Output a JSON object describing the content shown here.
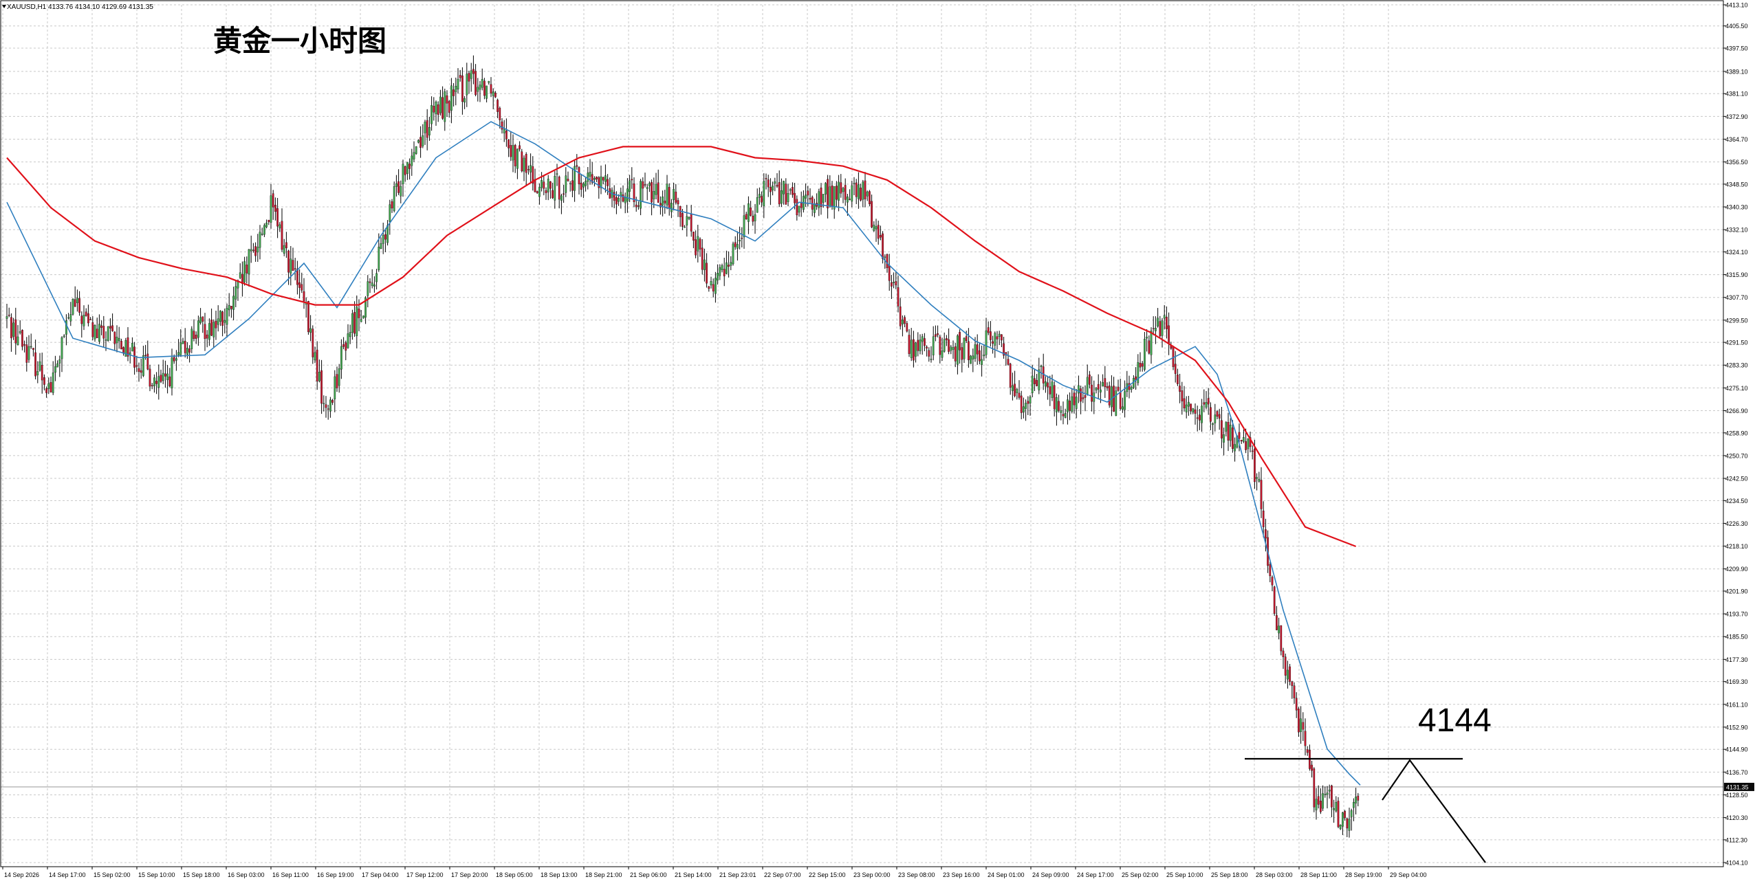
{
  "symbol_header": "XAUUSD,H1  4133.76 4134.10 4129.69 4131.35",
  "chart_title": "黄金一小时图",
  "annotation_level_text": "4144",
  "current_price_label": "4131.35",
  "colors": {
    "background": "#ffffff",
    "grid": "#c8c8c8",
    "bull_candle": "#3fa34d",
    "bear_candle": "#c0162c",
    "wick": "#000000",
    "ma_fast": "#2f7fbf",
    "ma_slow": "#e0111a",
    "annotation": "#000000",
    "price_tag_bg": "#0a0a0a",
    "price_tag_text": "#ffffff"
  },
  "chart_data": {
    "type": "candlestick",
    "symbol": "XAUUSD",
    "timeframe": "H1",
    "ylim": [
      4104.1,
      4413.1
    ],
    "y_ticks": [
      "4413.10",
      "4405.50",
      "4397.50",
      "4389.10",
      "4381.10",
      "4372.90",
      "4364.70",
      "4356.50",
      "4348.50",
      "4340.30",
      "4332.10",
      "4324.10",
      "4315.90",
      "4307.70",
      "4299.50",
      "4291.50",
      "4283.30",
      "4275.10",
      "4266.90",
      "4258.90",
      "4250.70",
      "4242.50",
      "4234.50",
      "4226.30",
      "4218.10",
      "4209.90",
      "4201.90",
      "4193.70",
      "4185.50",
      "4177.30",
      "4169.30",
      "4161.10",
      "4152.90",
      "4144.90",
      "4136.70",
      "4128.50",
      "4120.30",
      "4112.30",
      "4104.10"
    ],
    "x_ticks": [
      "14 Sep 2026",
      "14 Sep 17:00",
      "15 Sep 02:00",
      "15 Sep 10:00",
      "15 Sep 18:00",
      "16 Sep 03:00",
      "16 Sep 11:00",
      "16 Sep 19:00",
      "17 Sep 04:00",
      "17 Sep 12:00",
      "17 Sep 20:00",
      "18 Sep 05:00",
      "18 Sep 13:00",
      "18 Sep 21:00",
      "21 Sep 06:00",
      "21 Sep 14:00",
      "21 Sep 23:01",
      "22 Sep 07:00",
      "22 Sep 15:00",
      "23 Sep 00:00",
      "23 Sep 08:00",
      "23 Sep 16:00",
      "24 Sep 01:00",
      "24 Sep 09:00",
      "24 Sep 17:00",
      "25 Sep 02:00",
      "25 Sep 10:00",
      "25 Sep 18:00",
      "28 Sep 03:00",
      "28 Sep 11:00",
      "28 Sep 19:00",
      "29 Sep 04:00"
    ],
    "close_path": [
      [
        0,
        4300
      ],
      [
        10,
        4288
      ],
      [
        20,
        4275
      ],
      [
        30,
        4305
      ],
      [
        40,
        4295
      ],
      [
        55,
        4290
      ],
      [
        70,
        4275
      ],
      [
        85,
        4295
      ],
      [
        100,
        4300
      ],
      [
        110,
        4320
      ],
      [
        120,
        4340
      ],
      [
        135,
        4305
      ],
      [
        145,
        4265
      ],
      [
        155,
        4295
      ],
      [
        165,
        4310
      ],
      [
        180,
        4355
      ],
      [
        195,
        4375
      ],
      [
        210,
        4385
      ],
      [
        220,
        4385
      ],
      [
        230,
        4360
      ],
      [
        245,
        4345
      ],
      [
        255,
        4350
      ],
      [
        265,
        4350
      ],
      [
        280,
        4345
      ],
      [
        300,
        4345
      ],
      [
        310,
        4335
      ],
      [
        320,
        4310
      ],
      [
        330,
        4325
      ],
      [
        345,
        4350
      ],
      [
        360,
        4340
      ],
      [
        375,
        4345
      ],
      [
        390,
        4345
      ],
      [
        400,
        4320
      ],
      [
        410,
        4290
      ],
      [
        425,
        4290
      ],
      [
        440,
        4288
      ],
      [
        450,
        4295
      ],
      [
        460,
        4270
      ],
      [
        470,
        4280
      ],
      [
        480,
        4265
      ],
      [
        490,
        4275
      ],
      [
        505,
        4270
      ],
      [
        515,
        4285
      ],
      [
        525,
        4300
      ],
      [
        535,
        4270
      ],
      [
        545,
        4265
      ],
      [
        555,
        4258
      ],
      [
        565,
        4255
      ],
      [
        570,
        4233
      ],
      [
        575,
        4200
      ],
      [
        580,
        4175
      ],
      [
        585,
        4160
      ],
      [
        590,
        4150
      ],
      [
        595,
        4122
      ],
      [
        600,
        4130
      ],
      [
        605,
        4120
      ],
      [
        610,
        4118
      ],
      [
        615,
        4131
      ]
    ],
    "series": [
      {
        "name": "MA fast",
        "values": [
          [
            0,
            4342
          ],
          [
            30,
            4293
          ],
          [
            60,
            4286
          ],
          [
            90,
            4287
          ],
          [
            110,
            4300
          ],
          [
            135,
            4320
          ],
          [
            150,
            4304
          ],
          [
            170,
            4330
          ],
          [
            195,
            4358
          ],
          [
            220,
            4371
          ],
          [
            240,
            4363
          ],
          [
            255,
            4355
          ],
          [
            275,
            4345
          ],
          [
            290,
            4342
          ],
          [
            320,
            4336
          ],
          [
            340,
            4328
          ],
          [
            360,
            4342
          ],
          [
            380,
            4340
          ],
          [
            400,
            4320
          ],
          [
            420,
            4305
          ],
          [
            440,
            4292
          ],
          [
            460,
            4285
          ],
          [
            480,
            4276
          ],
          [
            500,
            4270
          ],
          [
            520,
            4282
          ],
          [
            540,
            4290
          ],
          [
            550,
            4280
          ],
          [
            560,
            4255
          ],
          [
            570,
            4225
          ],
          [
            580,
            4195
          ],
          [
            590,
            4170
          ],
          [
            600,
            4145
          ],
          [
            610,
            4136
          ],
          [
            615,
            4132
          ]
        ]
      },
      {
        "name": "MA slow",
        "values": [
          [
            0,
            4358
          ],
          [
            20,
            4340
          ],
          [
            40,
            4328
          ],
          [
            60,
            4322
          ],
          [
            80,
            4318
          ],
          [
            100,
            4315
          ],
          [
            120,
            4309
          ],
          [
            140,
            4305
          ],
          [
            160,
            4305
          ],
          [
            180,
            4315
          ],
          [
            200,
            4330
          ],
          [
            220,
            4340
          ],
          [
            240,
            4350
          ],
          [
            260,
            4358
          ],
          [
            280,
            4362
          ],
          [
            300,
            4362
          ],
          [
            320,
            4362
          ],
          [
            340,
            4358
          ],
          [
            360,
            4357
          ],
          [
            380,
            4355
          ],
          [
            400,
            4350
          ],
          [
            420,
            4340
          ],
          [
            440,
            4328
          ],
          [
            460,
            4317
          ],
          [
            480,
            4310
          ],
          [
            500,
            4302
          ],
          [
            520,
            4295
          ],
          [
            540,
            4285
          ],
          [
            555,
            4270
          ],
          [
            570,
            4250
          ],
          [
            590,
            4225
          ],
          [
            613,
            4218
          ]
        ]
      }
    ]
  }
}
